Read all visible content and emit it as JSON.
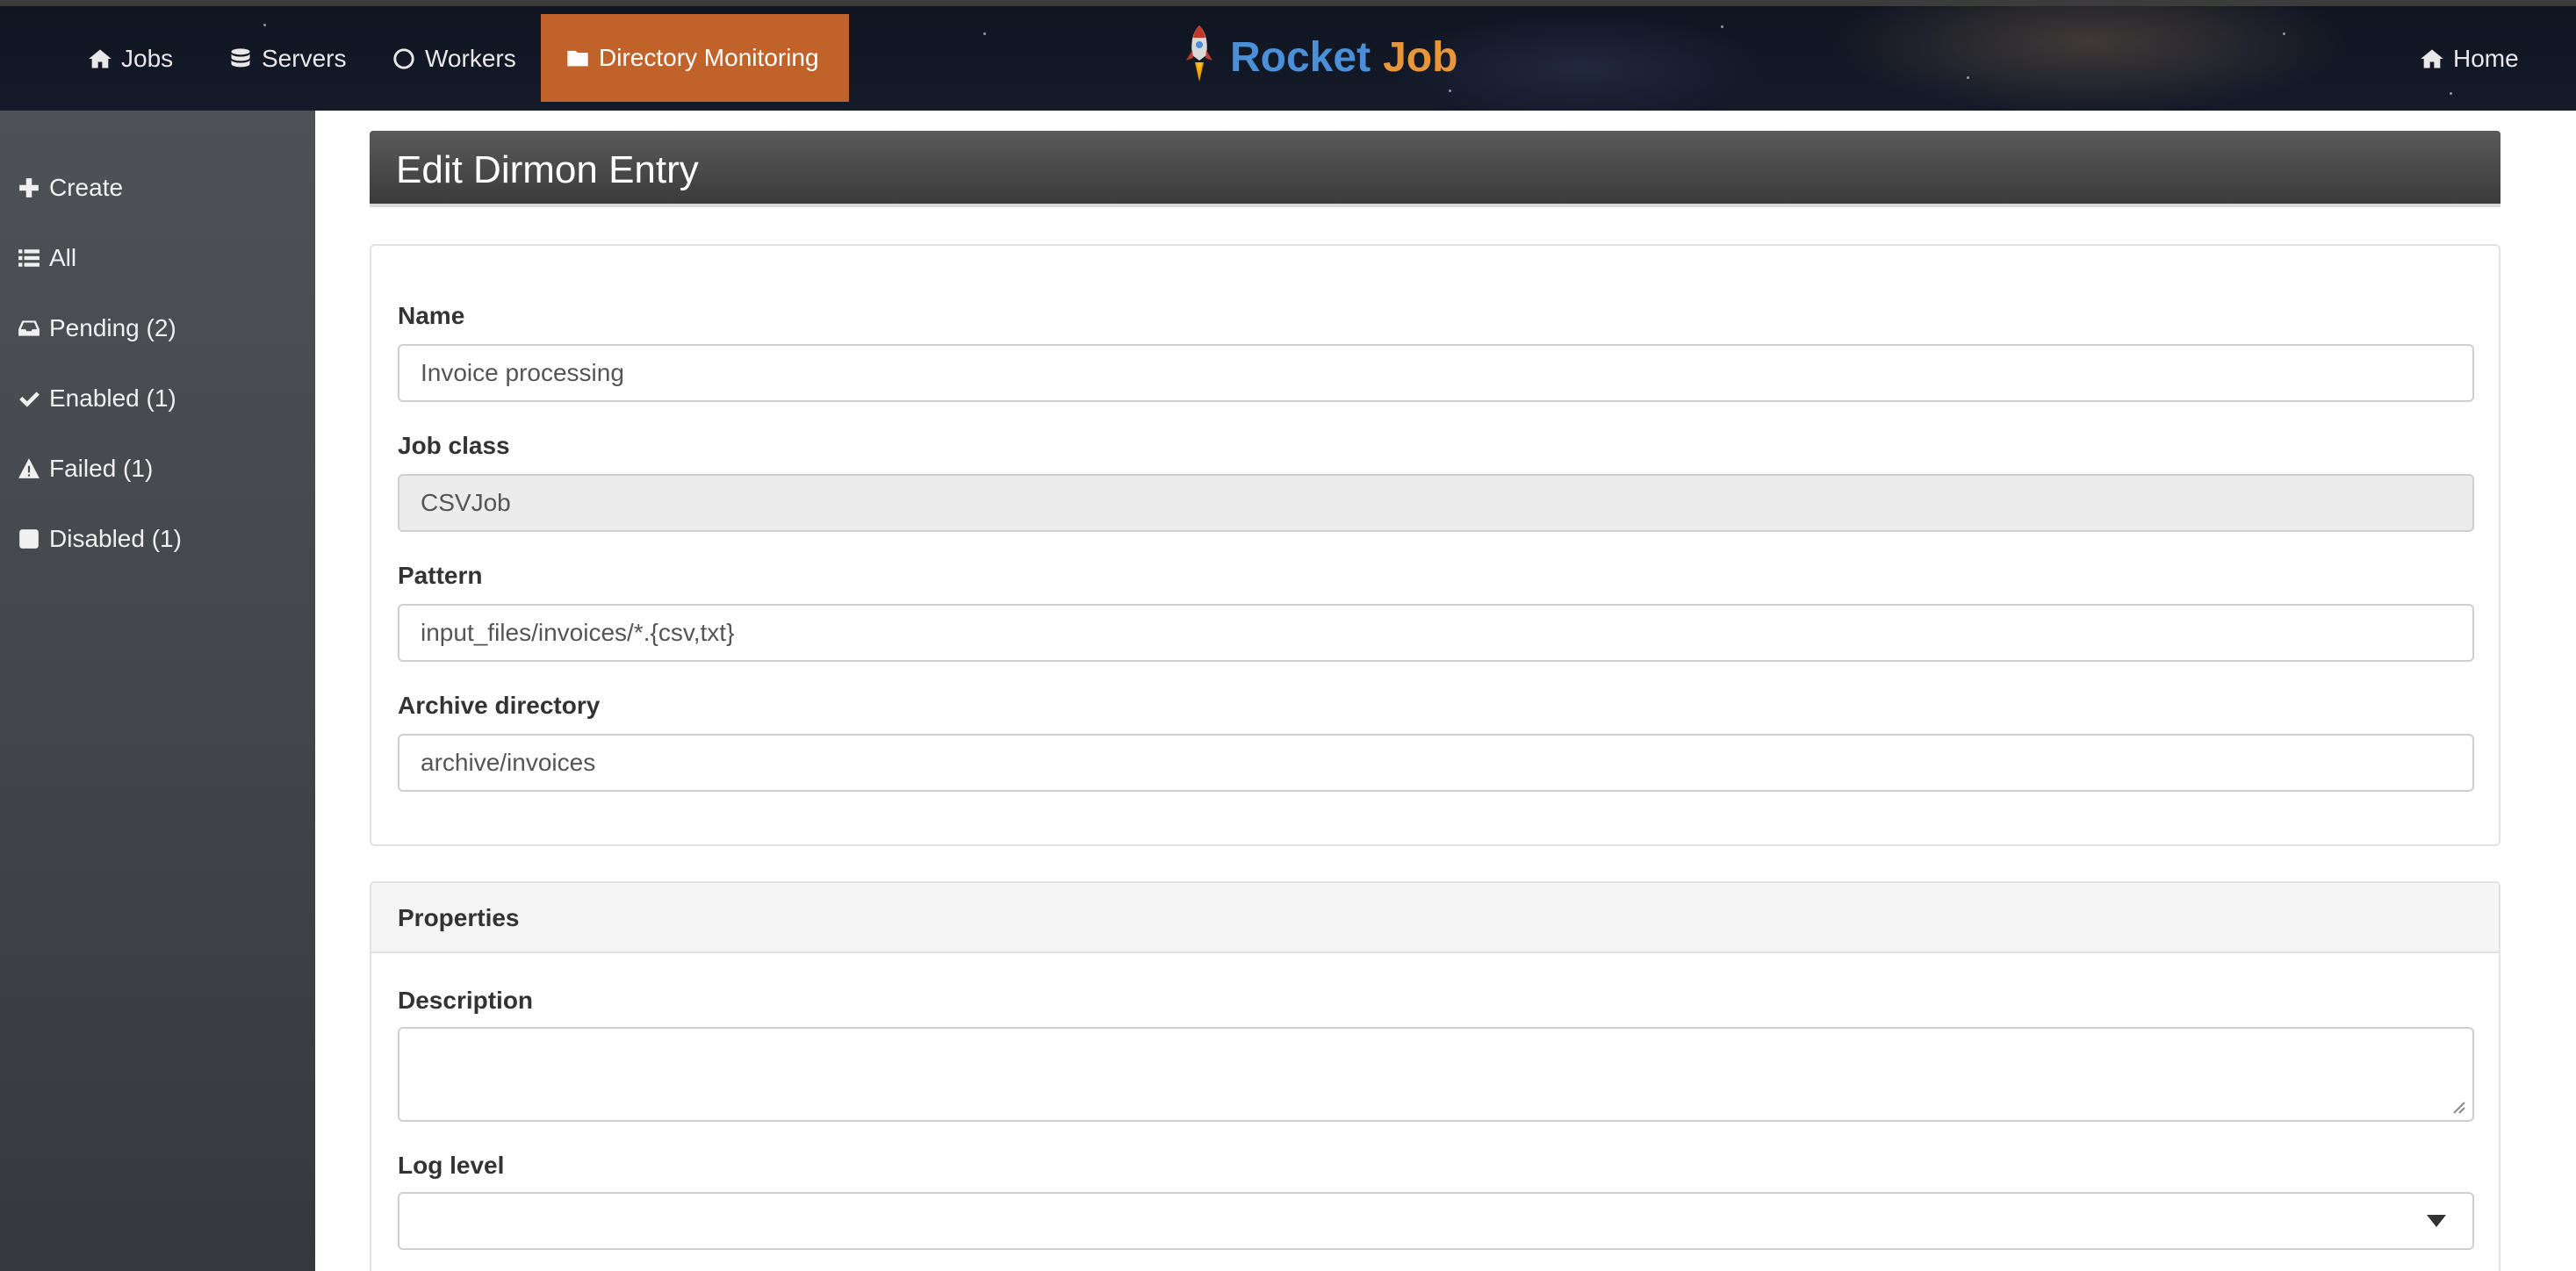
{
  "nav": {
    "items": [
      {
        "label": "Jobs",
        "icon": "home-icon"
      },
      {
        "label": "Servers",
        "icon": "database-icon"
      },
      {
        "label": "Workers",
        "icon": "circle-icon"
      },
      {
        "label": "Directory Monitoring",
        "icon": "folder-icon",
        "active": true
      }
    ],
    "brand": {
      "part1": "Rocket",
      "part2": "Job",
      "icon": "rocket-icon"
    },
    "right": {
      "label": "Home",
      "icon": "home-icon"
    },
    "active_color": "#c0622a"
  },
  "sidebar": {
    "items": [
      {
        "label": "Create",
        "icon": "plus-icon"
      },
      {
        "label": "All",
        "icon": "list-icon"
      },
      {
        "label": "Pending (2)",
        "icon": "inbox-icon"
      },
      {
        "label": "Enabled (1)",
        "icon": "check-icon"
      },
      {
        "label": "Failed (1)",
        "icon": "warning-icon"
      },
      {
        "label": "Disabled (1)",
        "icon": "stop-icon"
      }
    ]
  },
  "page": {
    "title": "Edit Dirmon Entry"
  },
  "form": {
    "name": {
      "label": "Name",
      "value": "Invoice processing"
    },
    "job_class": {
      "label": "Job class",
      "value": "CSVJob"
    },
    "pattern": {
      "label": "Pattern",
      "value": "input_files/invoices/*.{csv,txt}"
    },
    "archive_directory": {
      "label": "Archive directory",
      "value": "archive/invoices"
    }
  },
  "properties": {
    "heading": "Properties",
    "description": {
      "label": "Description",
      "value": ""
    },
    "log_level": {
      "label": "Log level",
      "value": ""
    }
  }
}
